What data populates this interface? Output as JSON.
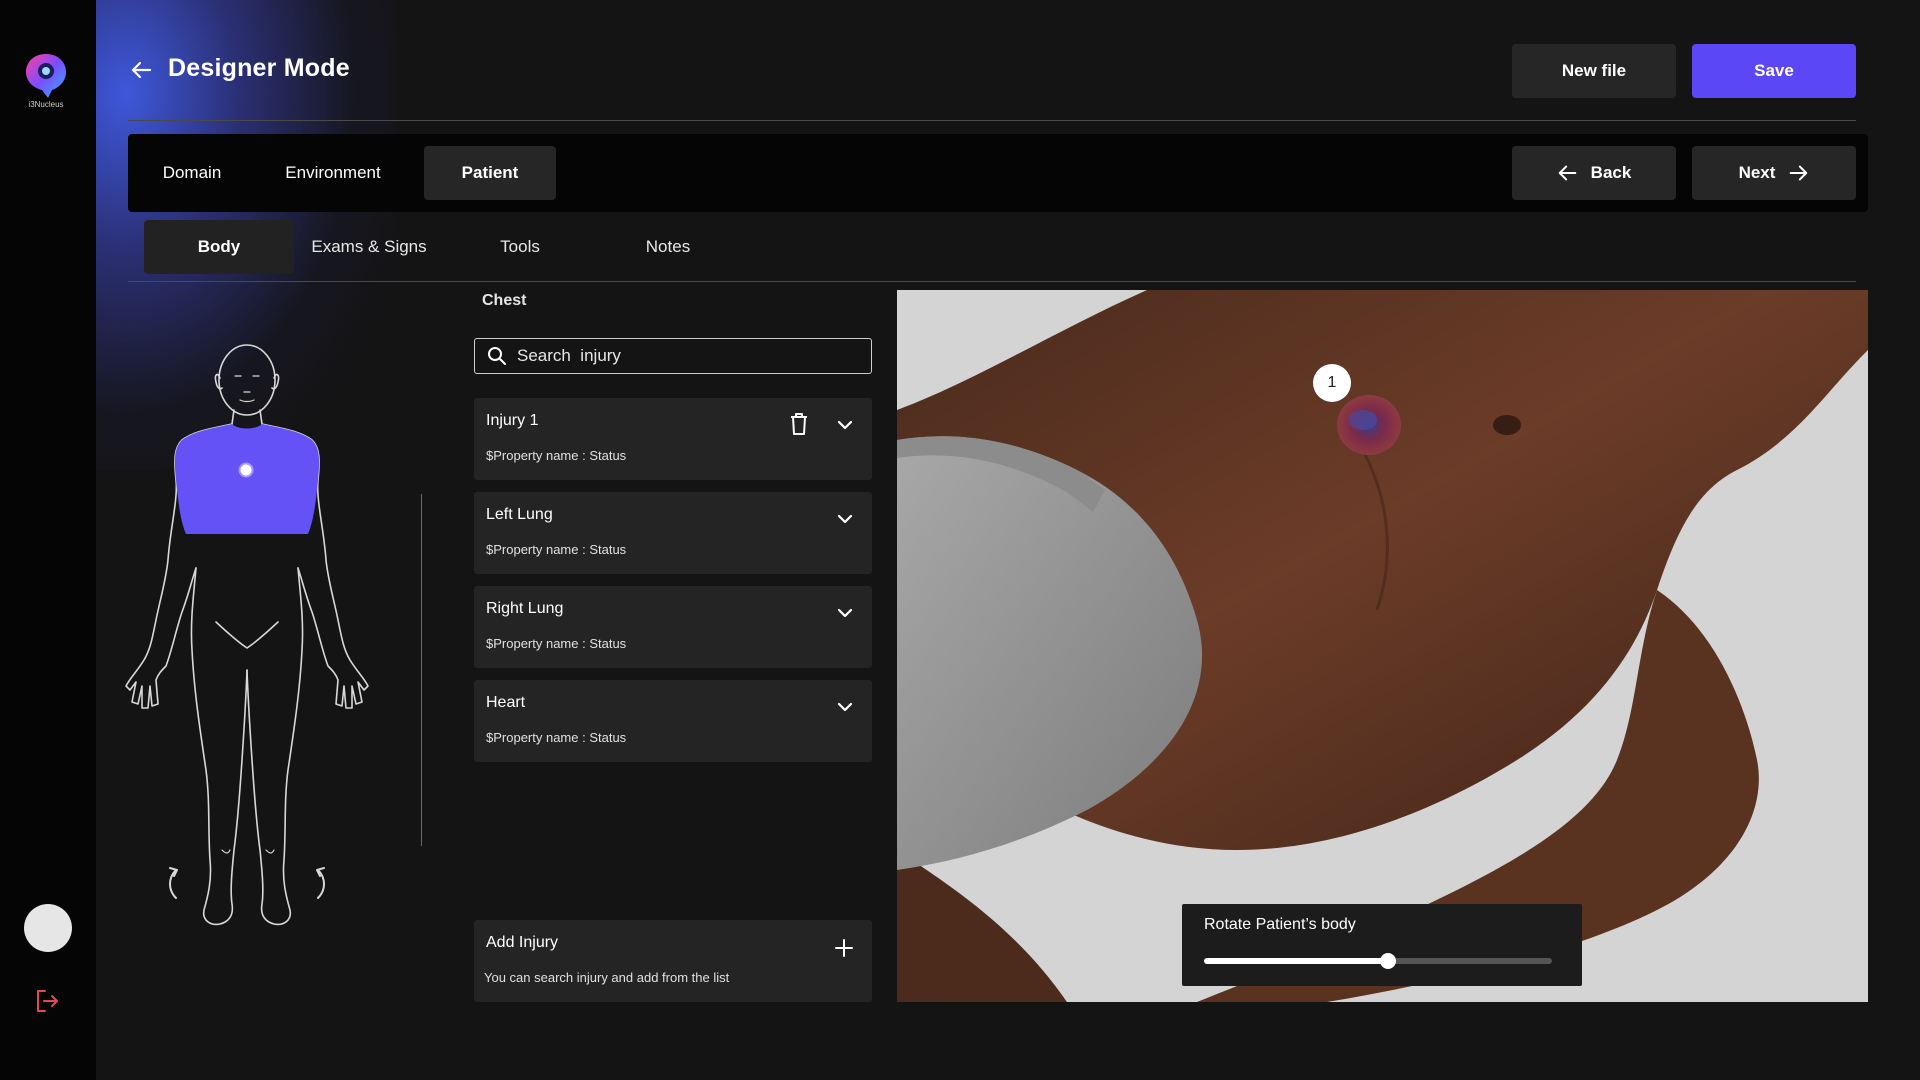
{
  "app": {
    "logo_text": "i3Nucleus",
    "title": "Designer Mode"
  },
  "header": {
    "new_file_label": "New file",
    "save_label": "Save"
  },
  "tabs": [
    {
      "label": "Domain",
      "active": false
    },
    {
      "label": "Environment",
      "active": false
    },
    {
      "label": "Patient",
      "active": true
    }
  ],
  "nav": {
    "back_label": "Back",
    "next_label": "Next"
  },
  "subtabs": [
    {
      "label": "Body",
      "active": true
    },
    {
      "label": "Exams & Signs",
      "active": false
    },
    {
      "label": "Tools",
      "active": false
    },
    {
      "label": "Notes",
      "active": false
    }
  ],
  "body_map": {
    "selected_region": "chest"
  },
  "injury_panel": {
    "section_label": "Chest",
    "search_placeholder": "Search  injury",
    "items": [
      {
        "title": "Injury 1",
        "subtitle": "$Property name : Status",
        "deletable": true
      },
      {
        "title": "Left Lung",
        "subtitle": "$Property name : Status",
        "deletable": false
      },
      {
        "title": "Right Lung",
        "subtitle": "$Property name : Status",
        "deletable": false
      },
      {
        "title": "Heart",
        "subtitle": "$Property name : Status",
        "deletable": false
      }
    ],
    "add": {
      "title": "Add Injury",
      "subtitle": "You can search injury and add from the list"
    }
  },
  "viewport": {
    "marker_label": "1",
    "rotate_label": "Rotate Patient’s body",
    "rotate_value_pct": 53
  },
  "colors": {
    "accent": "#5b47f5",
    "body_highlight": "#6552f7",
    "logout_red": "#e04a55"
  }
}
